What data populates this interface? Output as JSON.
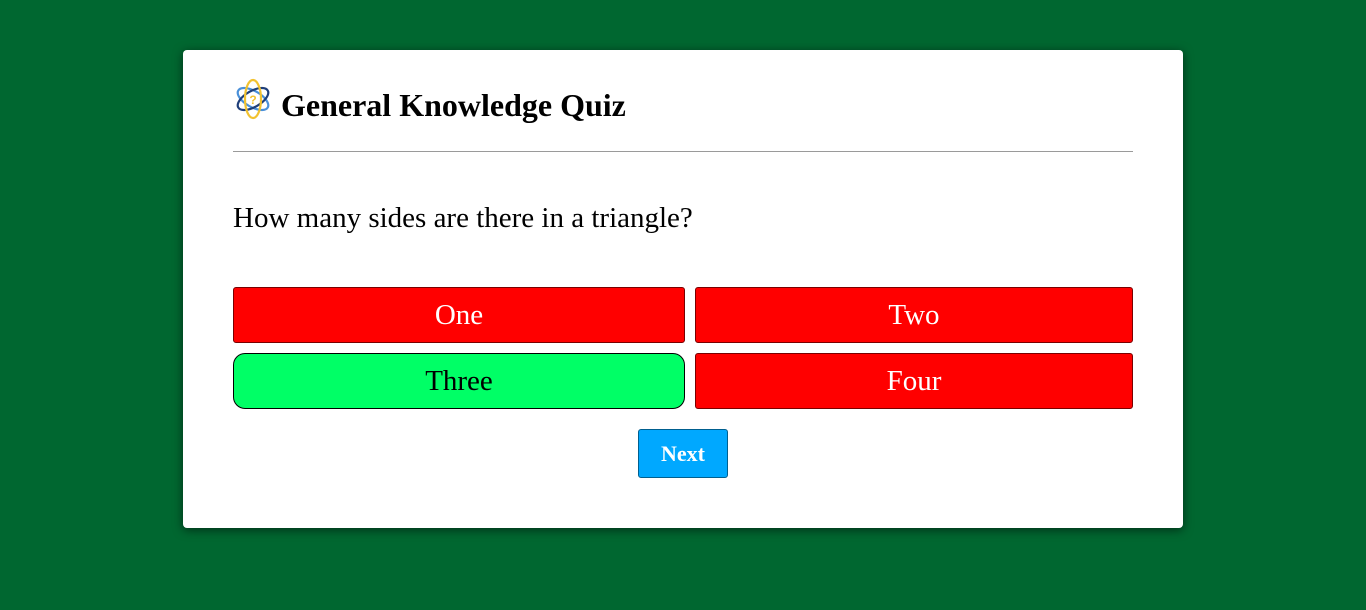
{
  "quiz": {
    "title": "General Knowledge Quiz",
    "logo_icon": "atom-quiz-icon",
    "question": "How many sides are there in a triangle?",
    "answers": [
      {
        "label": "One",
        "state": "wrong"
      },
      {
        "label": "Two",
        "state": "wrong"
      },
      {
        "label": "Three",
        "state": "correct"
      },
      {
        "label": "Four",
        "state": "wrong"
      }
    ],
    "next_label": "Next"
  },
  "colors": {
    "background": "#006730",
    "wrong": "#ff0000",
    "correct": "#00ff66",
    "next_button": "#00a8ff"
  }
}
